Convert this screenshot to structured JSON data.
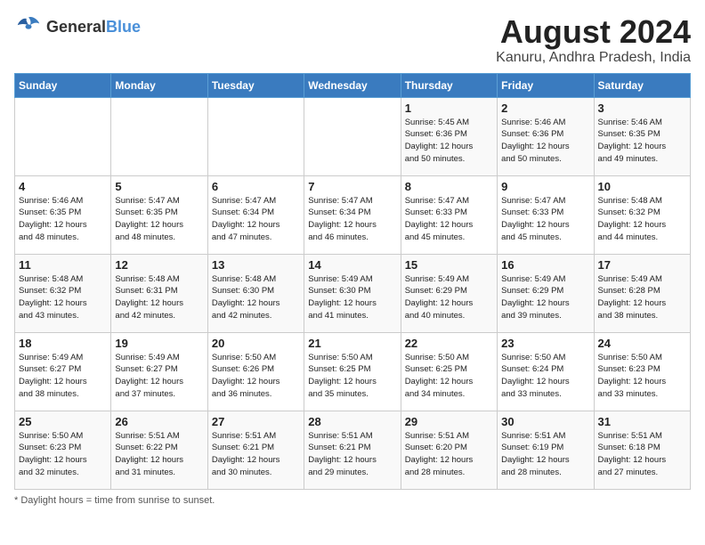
{
  "header": {
    "logo_general": "General",
    "logo_blue": "Blue",
    "month_year": "August 2024",
    "location": "Kanuru, Andhra Pradesh, India"
  },
  "days_of_week": [
    "Sunday",
    "Monday",
    "Tuesday",
    "Wednesday",
    "Thursday",
    "Friday",
    "Saturday"
  ],
  "weeks": [
    [
      {
        "day": "",
        "info": ""
      },
      {
        "day": "",
        "info": ""
      },
      {
        "day": "",
        "info": ""
      },
      {
        "day": "",
        "info": ""
      },
      {
        "day": "1",
        "info": "Sunrise: 5:45 AM\nSunset: 6:36 PM\nDaylight: 12 hours\nand 50 minutes."
      },
      {
        "day": "2",
        "info": "Sunrise: 5:46 AM\nSunset: 6:36 PM\nDaylight: 12 hours\nand 50 minutes."
      },
      {
        "day": "3",
        "info": "Sunrise: 5:46 AM\nSunset: 6:35 PM\nDaylight: 12 hours\nand 49 minutes."
      }
    ],
    [
      {
        "day": "4",
        "info": "Sunrise: 5:46 AM\nSunset: 6:35 PM\nDaylight: 12 hours\nand 48 minutes."
      },
      {
        "day": "5",
        "info": "Sunrise: 5:47 AM\nSunset: 6:35 PM\nDaylight: 12 hours\nand 48 minutes."
      },
      {
        "day": "6",
        "info": "Sunrise: 5:47 AM\nSunset: 6:34 PM\nDaylight: 12 hours\nand 47 minutes."
      },
      {
        "day": "7",
        "info": "Sunrise: 5:47 AM\nSunset: 6:34 PM\nDaylight: 12 hours\nand 46 minutes."
      },
      {
        "day": "8",
        "info": "Sunrise: 5:47 AM\nSunset: 6:33 PM\nDaylight: 12 hours\nand 45 minutes."
      },
      {
        "day": "9",
        "info": "Sunrise: 5:47 AM\nSunset: 6:33 PM\nDaylight: 12 hours\nand 45 minutes."
      },
      {
        "day": "10",
        "info": "Sunrise: 5:48 AM\nSunset: 6:32 PM\nDaylight: 12 hours\nand 44 minutes."
      }
    ],
    [
      {
        "day": "11",
        "info": "Sunrise: 5:48 AM\nSunset: 6:32 PM\nDaylight: 12 hours\nand 43 minutes."
      },
      {
        "day": "12",
        "info": "Sunrise: 5:48 AM\nSunset: 6:31 PM\nDaylight: 12 hours\nand 42 minutes."
      },
      {
        "day": "13",
        "info": "Sunrise: 5:48 AM\nSunset: 6:30 PM\nDaylight: 12 hours\nand 42 minutes."
      },
      {
        "day": "14",
        "info": "Sunrise: 5:49 AM\nSunset: 6:30 PM\nDaylight: 12 hours\nand 41 minutes."
      },
      {
        "day": "15",
        "info": "Sunrise: 5:49 AM\nSunset: 6:29 PM\nDaylight: 12 hours\nand 40 minutes."
      },
      {
        "day": "16",
        "info": "Sunrise: 5:49 AM\nSunset: 6:29 PM\nDaylight: 12 hours\nand 39 minutes."
      },
      {
        "day": "17",
        "info": "Sunrise: 5:49 AM\nSunset: 6:28 PM\nDaylight: 12 hours\nand 38 minutes."
      }
    ],
    [
      {
        "day": "18",
        "info": "Sunrise: 5:49 AM\nSunset: 6:27 PM\nDaylight: 12 hours\nand 38 minutes."
      },
      {
        "day": "19",
        "info": "Sunrise: 5:49 AM\nSunset: 6:27 PM\nDaylight: 12 hours\nand 37 minutes."
      },
      {
        "day": "20",
        "info": "Sunrise: 5:50 AM\nSunset: 6:26 PM\nDaylight: 12 hours\nand 36 minutes."
      },
      {
        "day": "21",
        "info": "Sunrise: 5:50 AM\nSunset: 6:25 PM\nDaylight: 12 hours\nand 35 minutes."
      },
      {
        "day": "22",
        "info": "Sunrise: 5:50 AM\nSunset: 6:25 PM\nDaylight: 12 hours\nand 34 minutes."
      },
      {
        "day": "23",
        "info": "Sunrise: 5:50 AM\nSunset: 6:24 PM\nDaylight: 12 hours\nand 33 minutes."
      },
      {
        "day": "24",
        "info": "Sunrise: 5:50 AM\nSunset: 6:23 PM\nDaylight: 12 hours\nand 33 minutes."
      }
    ],
    [
      {
        "day": "25",
        "info": "Sunrise: 5:50 AM\nSunset: 6:23 PM\nDaylight: 12 hours\nand 32 minutes."
      },
      {
        "day": "26",
        "info": "Sunrise: 5:51 AM\nSunset: 6:22 PM\nDaylight: 12 hours\nand 31 minutes."
      },
      {
        "day": "27",
        "info": "Sunrise: 5:51 AM\nSunset: 6:21 PM\nDaylight: 12 hours\nand 30 minutes."
      },
      {
        "day": "28",
        "info": "Sunrise: 5:51 AM\nSunset: 6:21 PM\nDaylight: 12 hours\nand 29 minutes."
      },
      {
        "day": "29",
        "info": "Sunrise: 5:51 AM\nSunset: 6:20 PM\nDaylight: 12 hours\nand 28 minutes."
      },
      {
        "day": "30",
        "info": "Sunrise: 5:51 AM\nSunset: 6:19 PM\nDaylight: 12 hours\nand 28 minutes."
      },
      {
        "day": "31",
        "info": "Sunrise: 5:51 AM\nSunset: 6:18 PM\nDaylight: 12 hours\nand 27 minutes."
      }
    ]
  ],
  "footer": {
    "note": "Daylight hours"
  }
}
